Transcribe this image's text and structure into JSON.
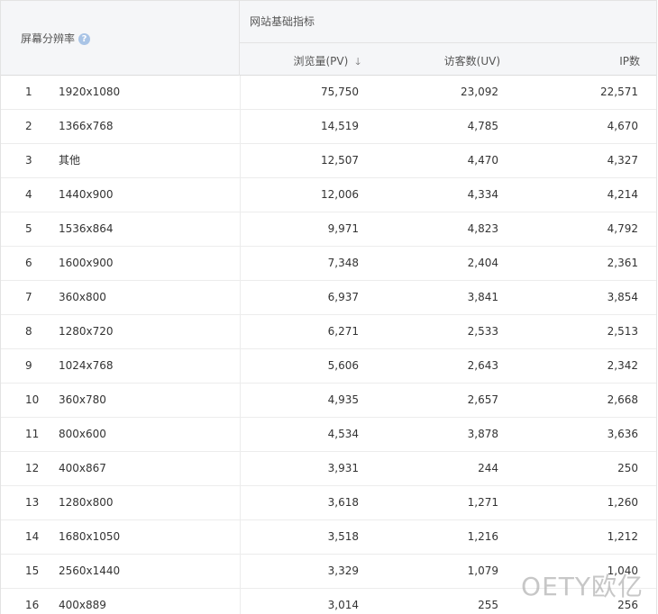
{
  "header": {
    "resolution_label": "屏幕分辨率",
    "help_icon": "?",
    "group_label": "网站基础指标",
    "pv_label": "浏览量(PV)",
    "sort_icon": "🡓",
    "uv_label": "访客数(UV)",
    "ip_label": "IP数"
  },
  "rows": [
    {
      "idx": "1",
      "res": "1920x1080",
      "pv": "75,750",
      "uv": "23,092",
      "ip": "22,571"
    },
    {
      "idx": "2",
      "res": "1366x768",
      "pv": "14,519",
      "uv": "4,785",
      "ip": "4,670"
    },
    {
      "idx": "3",
      "res": "其他",
      "pv": "12,507",
      "uv": "4,470",
      "ip": "4,327"
    },
    {
      "idx": "4",
      "res": "1440x900",
      "pv": "12,006",
      "uv": "4,334",
      "ip": "4,214"
    },
    {
      "idx": "5",
      "res": "1536x864",
      "pv": "9,971",
      "uv": "4,823",
      "ip": "4,792"
    },
    {
      "idx": "6",
      "res": "1600x900",
      "pv": "7,348",
      "uv": "2,404",
      "ip": "2,361"
    },
    {
      "idx": "7",
      "res": "360x800",
      "pv": "6,937",
      "uv": "3,841",
      "ip": "3,854"
    },
    {
      "idx": "8",
      "res": "1280x720",
      "pv": "6,271",
      "uv": "2,533",
      "ip": "2,513"
    },
    {
      "idx": "9",
      "res": "1024x768",
      "pv": "5,606",
      "uv": "2,643",
      "ip": "2,342"
    },
    {
      "idx": "10",
      "res": "360x780",
      "pv": "4,935",
      "uv": "2,657",
      "ip": "2,668"
    },
    {
      "idx": "11",
      "res": "800x600",
      "pv": "4,534",
      "uv": "3,878",
      "ip": "3,636"
    },
    {
      "idx": "12",
      "res": "400x867",
      "pv": "3,931",
      "uv": "244",
      "ip": "250"
    },
    {
      "idx": "13",
      "res": "1280x800",
      "pv": "3,618",
      "uv": "1,271",
      "ip": "1,260"
    },
    {
      "idx": "14",
      "res": "1680x1050",
      "pv": "3,518",
      "uv": "1,216",
      "ip": "1,212"
    },
    {
      "idx": "15",
      "res": "2560x1440",
      "pv": "3,329",
      "uv": "1,079",
      "ip": "1,040"
    },
    {
      "idx": "16",
      "res": "400x889",
      "pv": "3,014",
      "uv": "255",
      "ip": "256"
    }
  ],
  "watermark": "OETY欧亿"
}
